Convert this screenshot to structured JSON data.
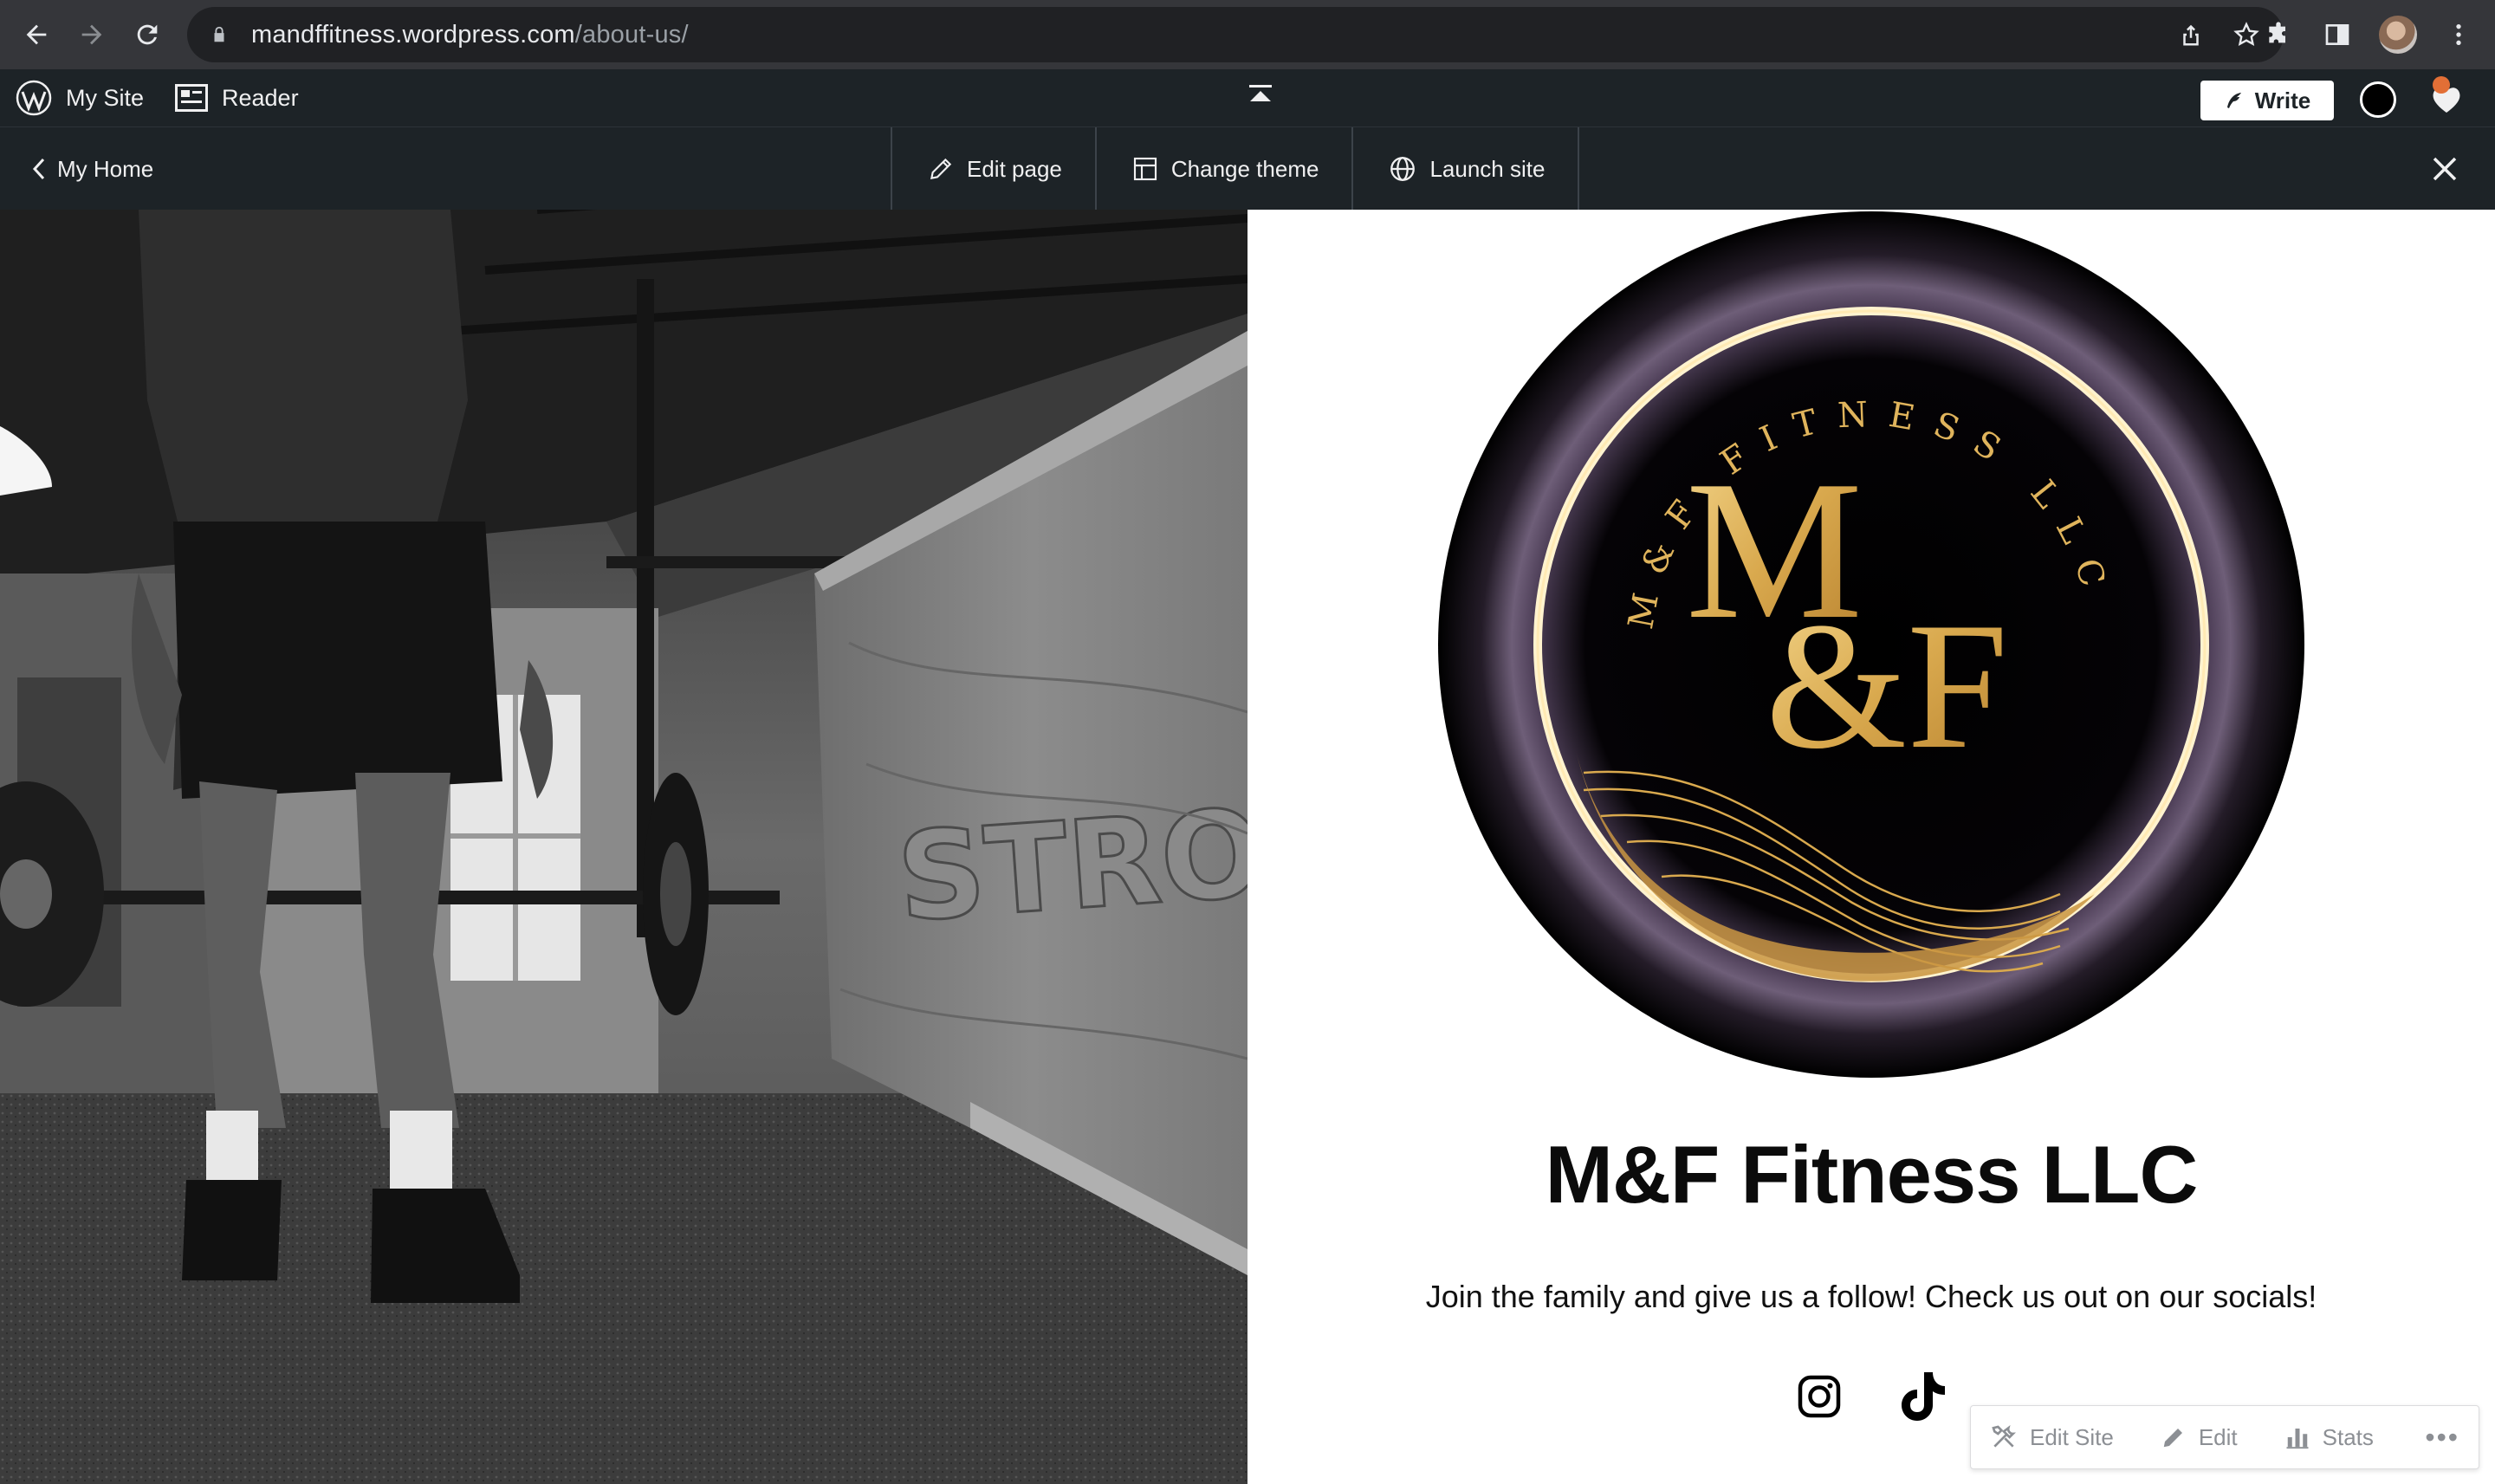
{
  "browser": {
    "url_host": "mandffitness.wordpress.com",
    "url_path": "/about-us/"
  },
  "admin_bar": {
    "my_site": "My Site",
    "reader": "Reader",
    "write": "Write"
  },
  "site_toolbar": {
    "my_home": "My Home",
    "edit_page": "Edit page",
    "change_theme": "Change theme",
    "launch_site": "Launch site"
  },
  "logo": {
    "arc_text": "M&F FITNESS LLC",
    "monogram_top": "M",
    "monogram_bottom": "&F",
    "gold": "#d9a94e"
  },
  "hero_photo": {
    "box_lettering": "STRON"
  },
  "page": {
    "title": "M&F Fitness LLC",
    "tagline": "Join the family and give us a follow! Check us out on our socials!"
  },
  "socials": [
    "instagram-icon",
    "tiktok-icon"
  ],
  "action_bar": {
    "edit_site": "Edit Site",
    "edit": "Edit",
    "stats": "Stats",
    "more": "•••"
  },
  "colors": {
    "chrome_bg": "#35363a",
    "admin_bg": "#1d2327",
    "accent_orange": "#e26f36"
  }
}
